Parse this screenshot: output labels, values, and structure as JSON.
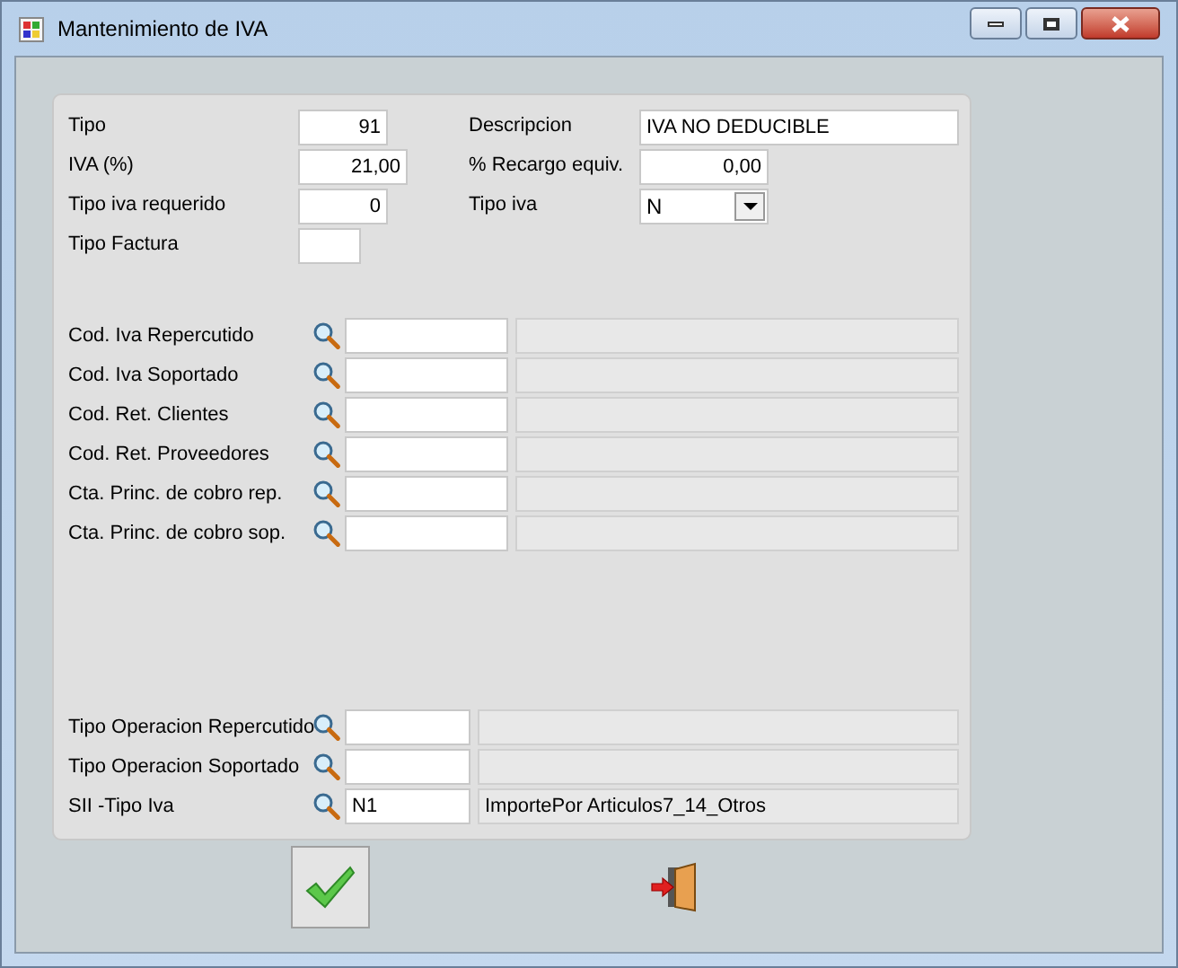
{
  "window": {
    "title": "Mantenimiento de IVA"
  },
  "top_rows": [
    {
      "left": {
        "label": "Tipo",
        "kind": "number",
        "value": "91"
      },
      "right": {
        "label": "Descripcion",
        "kind": "text",
        "value": "IVA NO DEDUCIBLE"
      }
    },
    {
      "left": {
        "label": "IVA (%)",
        "kind": "number",
        "value": "21,00"
      },
      "right": {
        "label": "% Recargo equiv.",
        "kind": "number",
        "value": "0,00"
      }
    },
    {
      "left": {
        "label": "Tipo iva requerido",
        "kind": "number",
        "value": "0"
      },
      "right": {
        "label": "Tipo iva",
        "kind": "select",
        "value": "N"
      }
    },
    {
      "left": {
        "label": "Tipo Factura",
        "kind": "number"
      }
    }
  ],
  "lookup_rows": [
    {
      "label": "Cod. Iva Repercutido"
    },
    {
      "label": "Cod. Iva Soportado"
    },
    {
      "label": "Cod. Ret. Clientes"
    },
    {
      "label": "Cod. Ret. Proveedores"
    },
    {
      "label": "Cta. Princ. de cobro  rep."
    },
    {
      "label": "Cta. Princ. de cobro  sop."
    }
  ],
  "operation_rows": [
    {
      "label": "Tipo Operacion Repercutido"
    },
    {
      "label": "Tipo Operacion Soportado"
    },
    {
      "label": "SII -Tipo Iva",
      "code": "N1",
      "description": "ImportePor Articulos7_14_Otros"
    }
  ]
}
